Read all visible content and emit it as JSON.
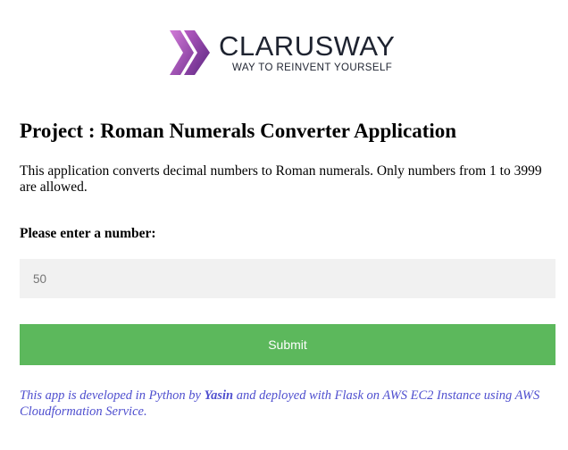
{
  "logo": {
    "name": "CLARUSWAY",
    "tagline": "WAY TO REINVENT YOURSELF",
    "colors": {
      "mark_light": "#c56fd1",
      "mark_dark": "#6b2f8f",
      "text": "#1e2330"
    }
  },
  "page": {
    "title": "Project : Roman Numerals Converter Application",
    "description": "This application converts decimal numbers to Roman numerals. Only numbers from 1 to 3999 are allowed.",
    "prompt": "Please enter a number:"
  },
  "form": {
    "number_placeholder": "50",
    "number_value": "",
    "submit_label": "Submit",
    "submit_color": "#5cb85c"
  },
  "footer": {
    "part1": "This app is developed in Python by ",
    "author": "Yasin",
    "part2": " and deployed with Flask on AWS EC2 Instance using AWS Cloudformation Service.",
    "color": "#4f4fcf"
  }
}
